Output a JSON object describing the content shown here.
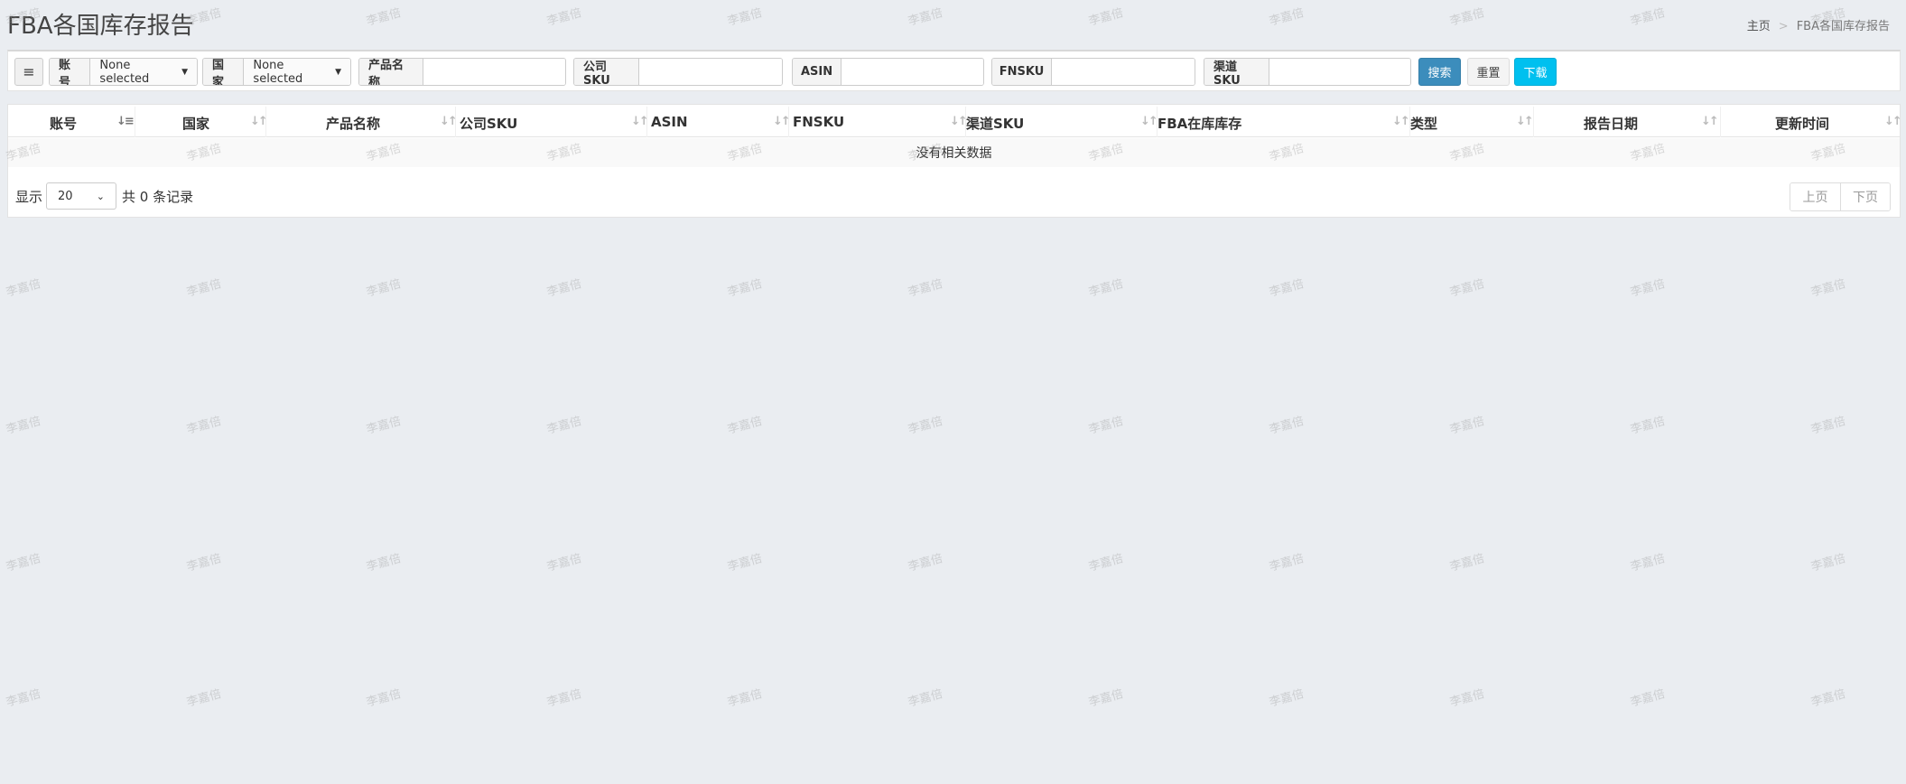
{
  "page": {
    "title": "FBA各国库存报告",
    "watermark": "李嘉倍"
  },
  "breadcrumb": {
    "home": "主页",
    "separator": ">",
    "current": "FBA各国库存报告"
  },
  "filters": {
    "menu_icon": "≡",
    "account": {
      "label": "账号",
      "value": "None selected"
    },
    "country": {
      "label": "国家",
      "value": "None selected"
    },
    "product_name": {
      "label": "产品名称",
      "value": ""
    },
    "company_sku": {
      "label": "公司SKU",
      "value": ""
    },
    "asin": {
      "label": "ASIN",
      "value": ""
    },
    "fnsku": {
      "label": "FNSKU",
      "value": ""
    },
    "channel_sku": {
      "label": "渠道SKU",
      "value": ""
    },
    "search_label": "搜索",
    "reset_label": "重置",
    "download_label": "下载"
  },
  "table": {
    "columns": [
      "账号",
      "国家",
      "产品名称",
      "公司SKU",
      "ASIN",
      "FNSKU",
      "渠道SKU",
      "FBA在库库存",
      "类型",
      "报告日期",
      "更新时间"
    ],
    "empty_text": "没有相关数据",
    "sort_icon": "↓↑",
    "sort_icon_active": "↓≡"
  },
  "pagination": {
    "show_label": "显示",
    "page_size": "20",
    "total_label": "共 0 条记录",
    "prev_label": "上页",
    "next_label": "下页"
  },
  "colors": {
    "background": "#eaedf1",
    "search_btn": "#3c8dbc",
    "download_btn": "#00c0ef"
  }
}
